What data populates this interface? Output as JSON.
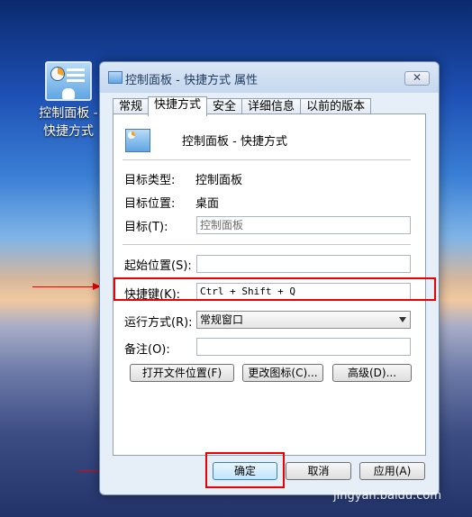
{
  "desktop": {
    "shortcut_label_line1": "控制面板 -",
    "shortcut_label_line2": "快捷方式"
  },
  "dialog": {
    "title": "控制面板 - 快捷方式 属性",
    "close_label": "✕",
    "tabs": [
      {
        "label": "常规"
      },
      {
        "label": "快捷方式"
      },
      {
        "label": "安全"
      },
      {
        "label": "详细信息"
      },
      {
        "label": "以前的版本"
      }
    ],
    "active_tab": "快捷方式",
    "app_name": "控制面板 - 快捷方式",
    "target_type_label": "目标类型:",
    "target_type_value": "控制面板",
    "target_location_label": "目标位置:",
    "target_location_value": "桌面",
    "target_label": "目标(T):",
    "target_value": "控制面板",
    "start_in_label": "起始位置(S):",
    "start_in_value": "",
    "shortcut_key_label": "快捷键(K):",
    "shortcut_key_value": "Ctrl + Shift + Q",
    "run_label": "运行方式(R):",
    "run_value": "常规窗口",
    "comment_label": "备注(O):",
    "comment_value": "",
    "open_location_btn": "打开文件位置(F)",
    "change_icon_btn": "更改图标(C)...",
    "advanced_btn": "高级(D)...",
    "ok_btn": "确定",
    "cancel_btn": "取消",
    "apply_btn": "应用(A)"
  },
  "watermark": "jingyan.baidu.com",
  "colors": {
    "annotation_red": "#e00000",
    "dialog_bg": "#e6eef8"
  }
}
